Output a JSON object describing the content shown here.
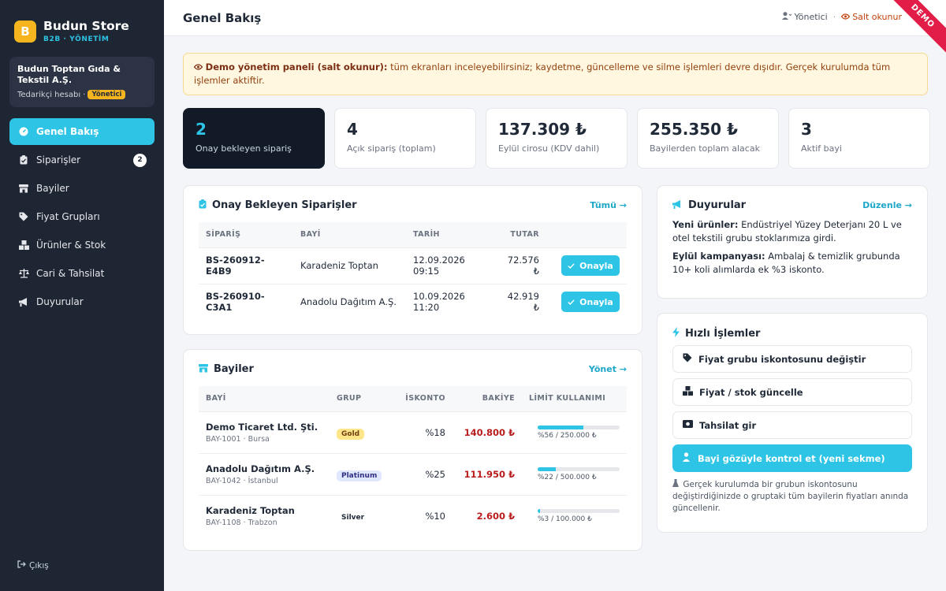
{
  "brand": {
    "logo_letter": "B",
    "name": "Budun Store",
    "subtitle": "B2B · YÖNETİM"
  },
  "account": {
    "name": "Budun Toptan Gıda & Tekstil A.Ş.",
    "type": "Tedarikçi hesabı ·",
    "role": "Yönetici"
  },
  "nav": [
    {
      "label": "Genel Bakış",
      "icon": "gauge-icon",
      "active": true
    },
    {
      "label": "Siparişler",
      "icon": "clipboard-icon",
      "count": "2"
    },
    {
      "label": "Bayiler",
      "icon": "store-icon"
    },
    {
      "label": "Fiyat Grupları",
      "icon": "tags-icon"
    },
    {
      "label": "Ürünler & Stok",
      "icon": "boxes-icon"
    },
    {
      "label": "Cari & Tahsilat",
      "icon": "scale-icon"
    },
    {
      "label": "Duyurular",
      "icon": "megaphone-icon"
    }
  ],
  "logout_label": "Çıkış",
  "header": {
    "title": "Genel Bakış",
    "user": "Yönetici",
    "mode": "Salt okunur",
    "ribbon": "DEMO"
  },
  "alert": {
    "title": "Demo yönetim paneli (salt okunur):",
    "text": " tüm ekranları inceleyebilirsiniz; kaydetme, güncelleme ve silme işlemleri devre dışıdır. Gerçek kurulumda tüm işlemler aktiftir."
  },
  "stats": [
    {
      "value": "2",
      "label": "Onay bekleyen sipariş"
    },
    {
      "value": "4",
      "label": "Açık sipariş (toplam)"
    },
    {
      "value": "137.309 ₺",
      "label": "Eylül cirosu (KDV dahil)"
    },
    {
      "value": "255.350 ₺",
      "label": "Bayilerden toplam alacak"
    },
    {
      "value": "3",
      "label": "Aktif bayi"
    }
  ],
  "pending": {
    "title": "Onay Bekleyen Siparişler",
    "link": "Tümü →",
    "columns": [
      "SİPARİŞ",
      "BAYİ",
      "TARİH",
      "TUTAR"
    ],
    "rows": [
      {
        "id": "BS-260912-E4B9",
        "dealer": "Karadeniz Toptan",
        "date": "12.09.2026 09:15",
        "amount": "72.576 ₺"
      },
      {
        "id": "BS-260910-C3A1",
        "dealer": "Anadolu Dağıtım A.Ş.",
        "date": "10.09.2026 11:20",
        "amount": "42.919 ₺"
      }
    ],
    "approve_label": "Onayla"
  },
  "dealers": {
    "title": "Bayiler",
    "link": "Yönet →",
    "columns": [
      "BAYİ",
      "GRUP",
      "İSKONTO",
      "BAKİYE",
      "LİMİT KULLANIMI"
    ],
    "rows": [
      {
        "name": "Demo Ticaret Ltd. Şti.",
        "code": "BAY-1001 · Bursa",
        "group": "Gold",
        "discount": "%18",
        "balance": "140.800 ₺",
        "usage": 0.56,
        "limit_text": "%56 / 250.000 ₺"
      },
      {
        "name": "Anadolu Dağıtım A.Ş.",
        "code": "BAY-1042 · İstanbul",
        "group": "Platinum",
        "discount": "%25",
        "balance": "111.950 ₺",
        "usage": 0.22,
        "limit_text": "%22 / 500.000 ₺"
      },
      {
        "name": "Karadeniz Toptan",
        "code": "BAY-1108 · Trabzon",
        "group": "Silver",
        "discount": "%10",
        "balance": "2.600 ₺",
        "usage": 0.03,
        "limit_text": "%3 / 100.000 ₺"
      }
    ]
  },
  "announcements": {
    "title": "Duyurular",
    "link": "Düzenle →",
    "items": [
      {
        "label": "Yeni ürünler:",
        "text": " Endüstriyel Yüzey Deterjanı 20 L ve otel tekstili grubu stoklarımıza girdi."
      },
      {
        "label": "Eylül kampanyası:",
        "text": " Ambalaj & temizlik grubunda 10+ koli alımlarda ek %3 iskonto."
      }
    ]
  },
  "quick": {
    "title": "Hızlı İşlemler",
    "actions": [
      {
        "label": "Fiyat grubu iskontosunu değiştir",
        "icon": "tags-icon"
      },
      {
        "label": "Fiyat / stok güncelle",
        "icon": "boxes-icon"
      },
      {
        "label": "Tahsilat gir",
        "icon": "money-icon"
      },
      {
        "label": "Bayi gözüyle kontrol et (yeni sekme)",
        "icon": "user-shield-icon"
      }
    ],
    "note": "Gerçek kurulumda bir grubun iskontosunu değiştirdiğinizde o gruptaki tüm bayilerin fiyatları anında güncellenir."
  },
  "colors": {
    "accent": "#2ec4e6",
    "sidebar": "#1e2533",
    "brand": "#f6b51e",
    "danger": "#b91c1c",
    "ribbon": "#e11d48"
  }
}
